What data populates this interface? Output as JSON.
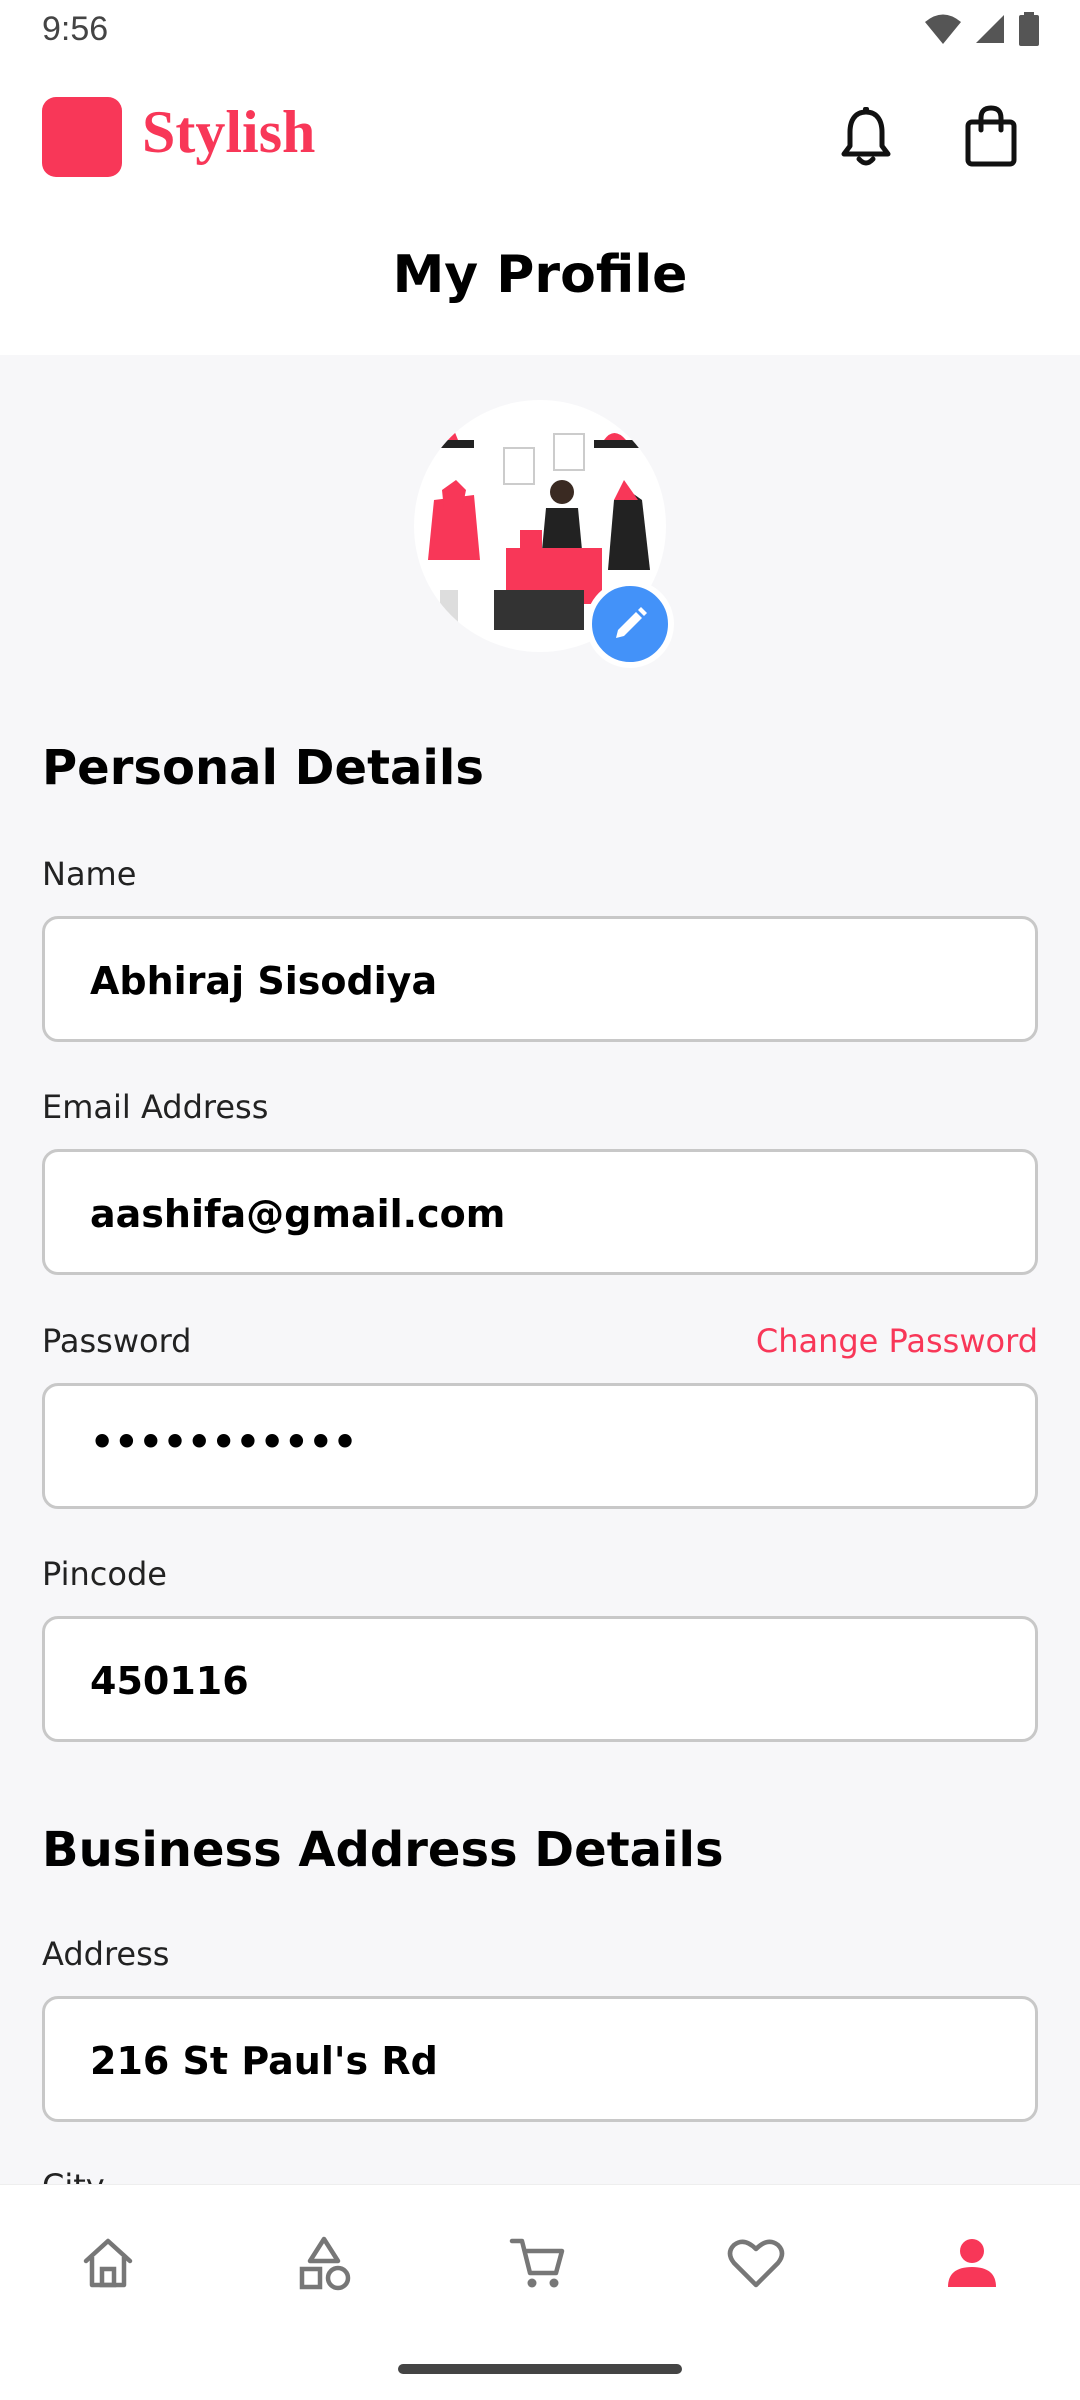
{
  "status": {
    "time": "9:56"
  },
  "header": {
    "brand": "Stylish"
  },
  "page": {
    "title": "My Profile"
  },
  "personal": {
    "title": "Personal Details",
    "name_label": "Name",
    "name_value": "Abhiraj Sisodiya",
    "email_label": "Email Address",
    "email_value": "aashifa@gmail.com",
    "password_label": "Password",
    "change_password": "Change Password",
    "password_value": "•••••••••••",
    "pincode_label": "Pincode",
    "pincode_value": "450116"
  },
  "business": {
    "title": "Business Address Details",
    "address_label": "Address",
    "address_value": "216 St Paul's Rd",
    "city_label": "City"
  },
  "nav": {
    "items": [
      "home-icon",
      "categories-icon",
      "cart-icon",
      "wishlist-icon",
      "profile-icon"
    ],
    "active": "profile-icon"
  },
  "colors": {
    "accent": "#F83758",
    "edit_badge": "#4392F9",
    "background": "#f7f7f9"
  }
}
